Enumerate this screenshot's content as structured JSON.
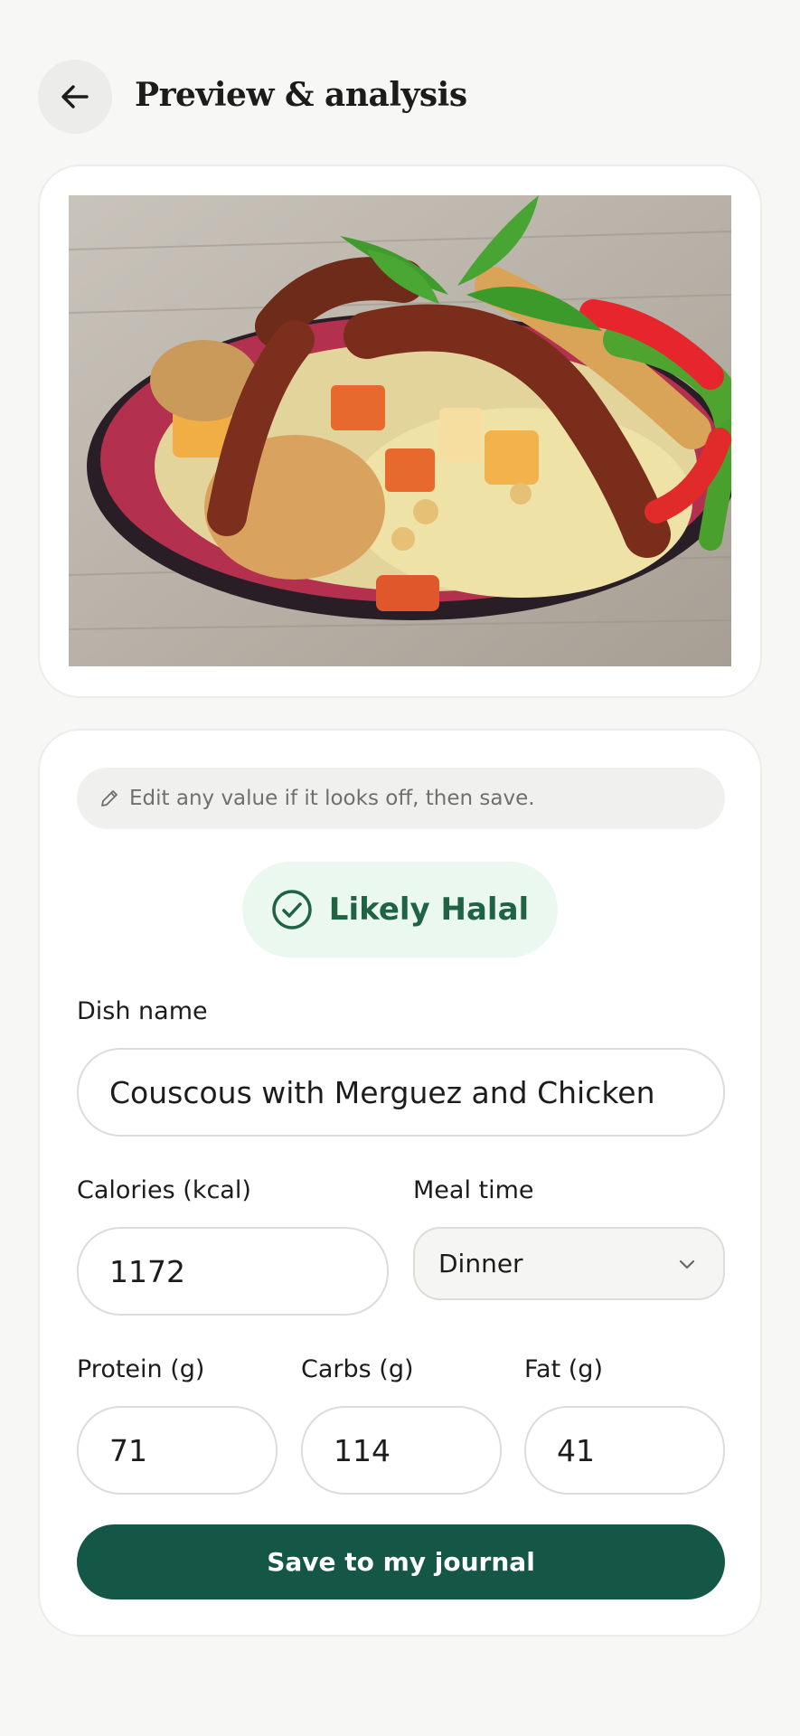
{
  "header": {
    "title": "Preview & analysis",
    "back_icon": "arrow-left-icon"
  },
  "photo": {
    "description_icon": "food-photo"
  },
  "hint": {
    "icon": "pencil-icon",
    "text": "Edit any value if it looks off, then save."
  },
  "halal": {
    "icon": "check-circle-icon",
    "label": "Likely Halal",
    "color": "#1f6244",
    "background": "#ebf8ef"
  },
  "form": {
    "dish_name_label": "Dish name",
    "dish_name_value": "Couscous with Merguez and Chicken",
    "calories_label": "Calories (kcal)",
    "calories_value": "1172",
    "meal_time_label": "Meal time",
    "meal_time_value": "Dinner",
    "protein_label": "Protein (g)",
    "protein_value": "71",
    "carbs_label": "Carbs (g)",
    "carbs_value": "114",
    "fat_label": "Fat (g)",
    "fat_value": "41"
  },
  "actions": {
    "save_label": "Save to my journal",
    "accent": "#145746"
  }
}
